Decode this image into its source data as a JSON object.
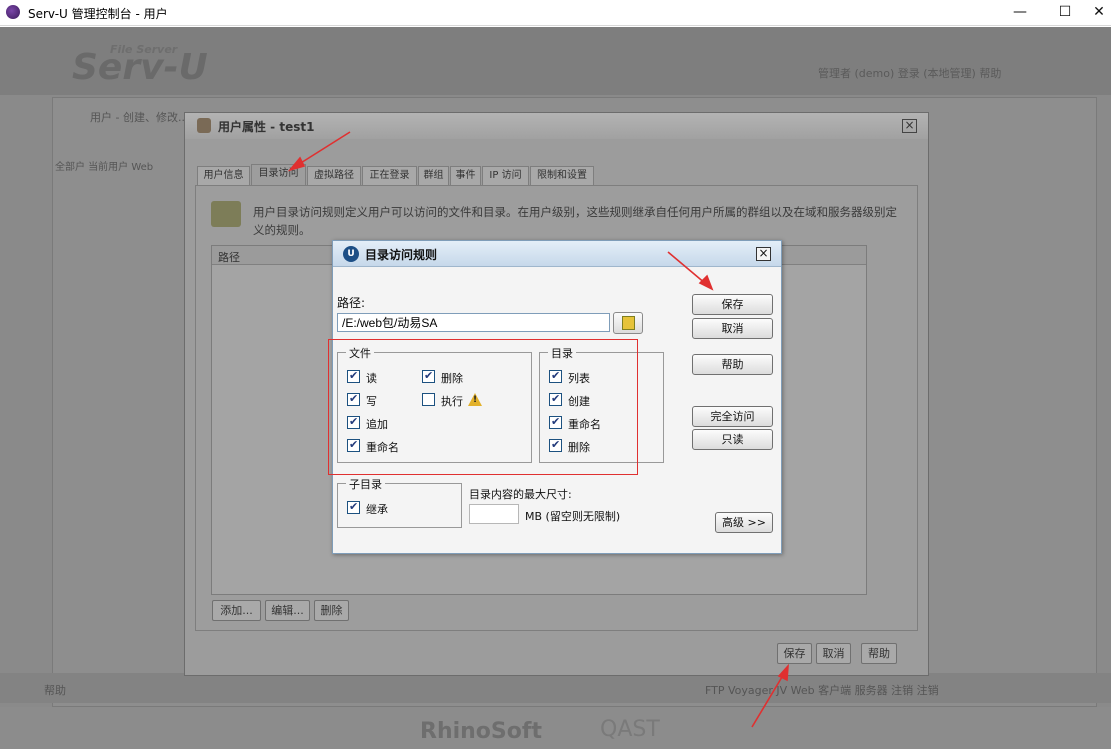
{
  "window": {
    "title": "Serv-U 管理控制台 - 用户",
    "minimize": "—",
    "maximize": "☐",
    "close": "✕"
  },
  "background_app": {
    "logo": "Serv-U",
    "logo_sub": "File Server",
    "topright": "管理者 (demo)   登录 (本地管理)   帮助",
    "breadcrumb": "用户 - 创建、修改...",
    "tabs": "全部户   当前用户   Web",
    "footer_left": "帮助",
    "footer_right": "FTP Voyager JV   Web 客户端   服务器   注销   注销",
    "brand1": "RhinoSoft",
    "brand2": "QAST"
  },
  "user_dialog": {
    "title": "用户属性 - test1",
    "tabs": [
      {
        "label": "用户信息"
      },
      {
        "label": "目录访问"
      },
      {
        "label": "虚拟路径"
      },
      {
        "label": "正在登录"
      },
      {
        "label": "群组"
      },
      {
        "label": "事件"
      },
      {
        "label": "IP 访问"
      },
      {
        "label": "限制和设置"
      }
    ],
    "active_tab": "目录访问",
    "description": "用户目录访问规则定义用户可以访问的文件和目录。在用户级别，这些规则继承自任何用户所属的群组以及在域和服务器级别定义的规则。",
    "table_header": "路径",
    "buttons": {
      "add": "添加...",
      "edit": "编辑...",
      "delete": "删除"
    },
    "footer": {
      "save": "保存",
      "cancel": "取消",
      "help": "帮助"
    }
  },
  "rule_dialog": {
    "title": "目录访问规则",
    "icon_text": "U",
    "path_label": "路径:",
    "path_value": "/E:/web包/动易SA",
    "files": {
      "legend": "文件",
      "read": {
        "label": "读",
        "checked": true
      },
      "write": {
        "label": "写",
        "checked": true
      },
      "append": {
        "label": "追加",
        "checked": true
      },
      "rename": {
        "label": "重命名",
        "checked": true
      },
      "delete": {
        "label": "删除",
        "checked": true
      },
      "execute": {
        "label": "执行",
        "checked": false
      }
    },
    "dirs": {
      "legend": "目录",
      "list": {
        "label": "列表",
        "checked": true
      },
      "create": {
        "label": "创建",
        "checked": true
      },
      "rename": {
        "label": "重命名",
        "checked": true
      },
      "delete": {
        "label": "删除",
        "checked": true
      }
    },
    "subdir": {
      "legend": "子目录",
      "inherit": {
        "label": "继承",
        "checked": true
      }
    },
    "max_size_label": "目录内容的最大尺寸:",
    "max_size_value": "",
    "mb_label": "MB  (留空则无限制)",
    "buttons": {
      "save": "保存",
      "cancel": "取消",
      "help": "帮助",
      "full_access": "完全访问",
      "read_only": "只读",
      "advanced": "高级 >>"
    }
  },
  "colors": {
    "annotation": "#e03030",
    "checkbox_border": "#1c5180",
    "dialog_titlebar": "#c6d8ea"
  }
}
